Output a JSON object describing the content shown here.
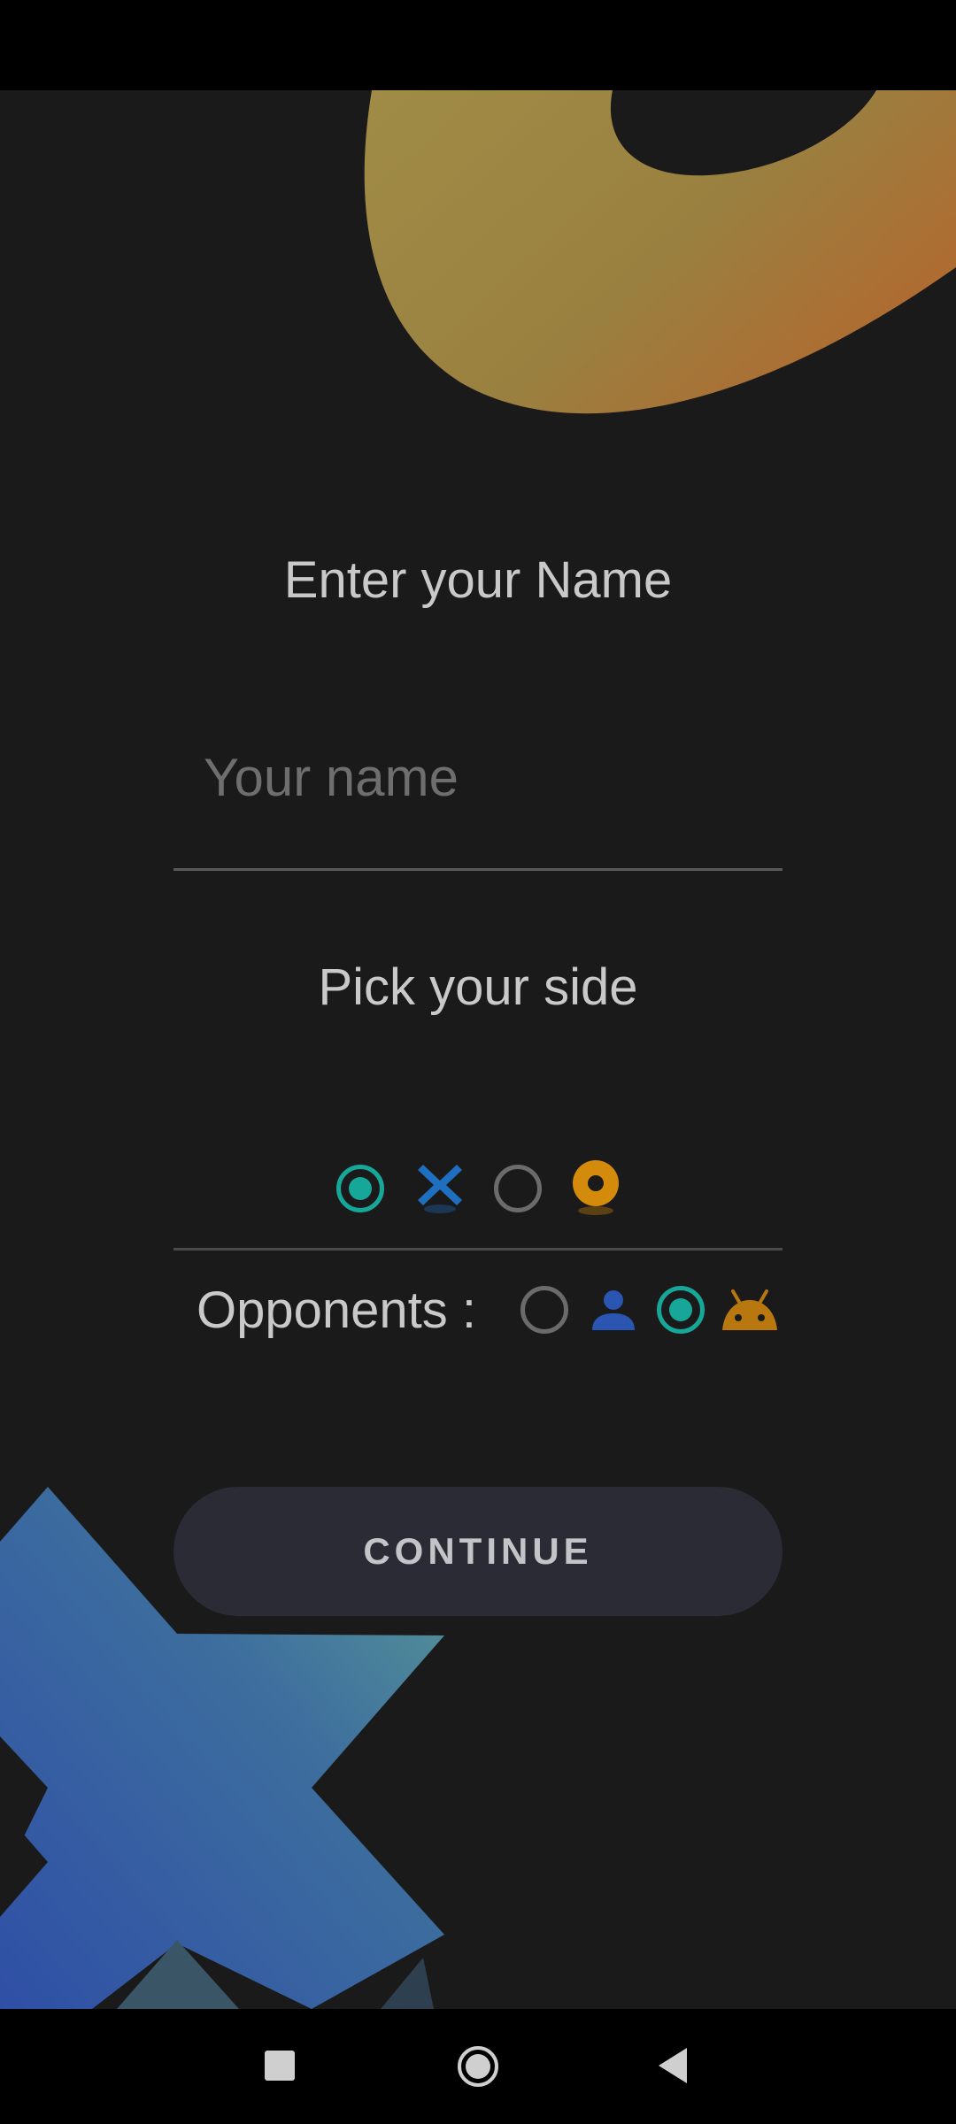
{
  "screen": {
    "title": "Enter your Name",
    "name_input": {
      "value": "",
      "placeholder": "Your name"
    },
    "side": {
      "label": "Pick your side",
      "options": [
        {
          "name": "cross",
          "selected": true,
          "icon": "x-mark-icon",
          "color": "#1e6fbf"
        },
        {
          "name": "circle",
          "selected": false,
          "icon": "o-ring-icon",
          "color": "#d48a0a"
        }
      ]
    },
    "opponents": {
      "label": "Opponents :",
      "options": [
        {
          "name": "human",
          "selected": false,
          "icon": "person-icon",
          "color": "#2a55b0"
        },
        {
          "name": "android",
          "selected": true,
          "icon": "android-icon",
          "color": "#b8770f"
        }
      ]
    },
    "continue_label": "CONTINUE"
  },
  "colors": {
    "background": "#1a1a1a",
    "radio_selected": "#17a799",
    "radio_unselected": "#6b6b6b",
    "text": "#c9c9c9"
  },
  "nav_bar": {
    "icons": [
      "square-recents-icon",
      "circle-home-icon",
      "triangle-back-icon"
    ]
  }
}
